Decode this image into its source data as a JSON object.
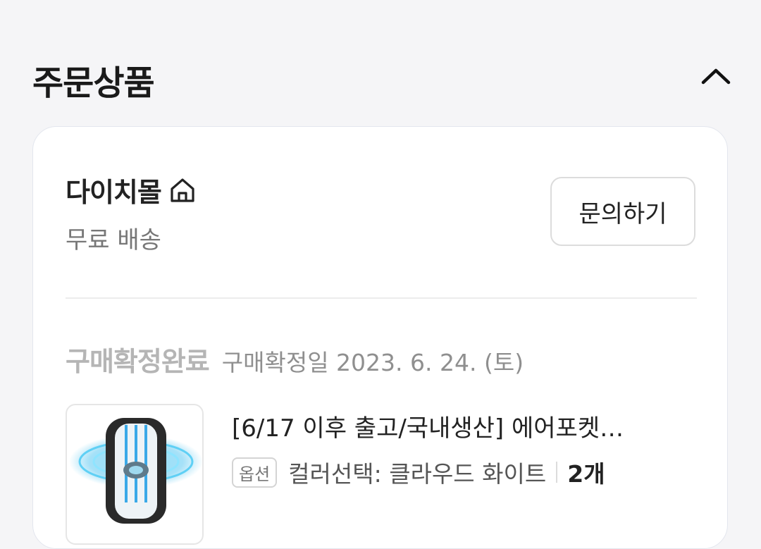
{
  "section": {
    "title": "주문상품",
    "collapse_icon": "chevron-up-icon"
  },
  "seller": {
    "name": "다이치몰",
    "home_icon": "home-icon",
    "shipping": "무료 배송",
    "inquiry_label": "문의하기"
  },
  "order": {
    "status": "구매확정완료",
    "confirm_date": "구매확정일 2023. 6. 24. (토)"
  },
  "product": {
    "title": "[6/17 이후 출고/국내생산] 에어포켓…",
    "option_badge": "옵션",
    "option_text": "컬러선택: 클라우드 화이트",
    "quantity": "2개"
  },
  "colors": {
    "background": "#f5f5f7",
    "card": "#ffffff",
    "status_gray": "#b5b5b5",
    "accent_blue": "#7fd3f5"
  }
}
